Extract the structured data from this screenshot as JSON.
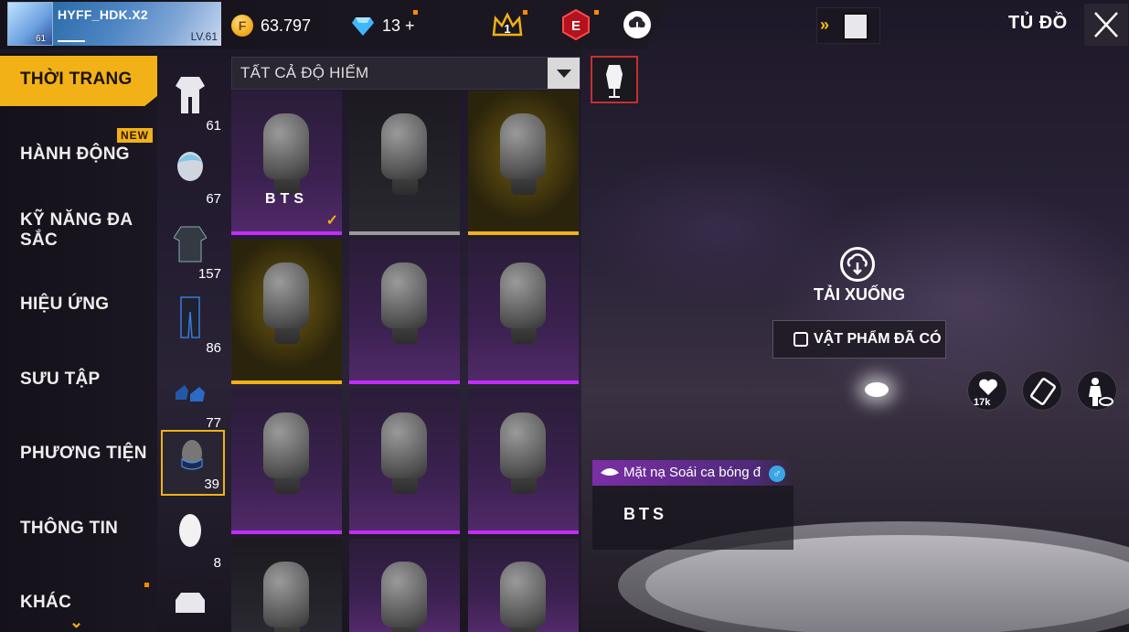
{
  "header": {
    "player_name": "HYFF_HDK.X2",
    "avatar_level": "61",
    "level_label": "LV.61",
    "coins": "63.797",
    "diamonds": "13",
    "diamond_plus": "+",
    "badge_rank": "1",
    "badge_elite": "E",
    "title": "TỦ ĐỒ",
    "forward_arrows": "»"
  },
  "menu": {
    "items": [
      {
        "label": "THỜI TRANG",
        "active": true
      },
      {
        "label": "HÀNH ĐỘNG",
        "badge": "NEW"
      },
      {
        "label": "KỸ NĂNG ĐA"
      },
      {
        "label": "SẮC"
      },
      {
        "label": "HIỆU ỨNG"
      },
      {
        "label": "SƯU TẬP"
      },
      {
        "label": "PHƯƠNG TIỆN"
      },
      {
        "label": "THÔNG TIN"
      },
      {
        "label": "KHÁC"
      }
    ],
    "more_arrow": "⌄"
  },
  "categories": [
    {
      "icon": "outfit-icon",
      "count": "61"
    },
    {
      "icon": "hair-icon",
      "count": "67"
    },
    {
      "icon": "top-icon",
      "count": "157"
    },
    {
      "icon": "pants-icon",
      "count": "86"
    },
    {
      "icon": "shoes-icon",
      "count": "77"
    },
    {
      "icon": "mask-icon",
      "count": "39",
      "selected": true
    },
    {
      "icon": "face-icon",
      "count": "8"
    },
    {
      "icon": "jacket-icon",
      "count": ""
    }
  ],
  "filter": {
    "label": "TẤT CẢ ĐỘ HIẾM"
  },
  "grid": {
    "items": [
      {
        "bg": "purple",
        "bar": "#c22cff",
        "text": "BTS",
        "equipped": true
      },
      {
        "bg": "dark",
        "bar": "#9a9a9a"
      },
      {
        "bg": "gold",
        "bar": "#f2b116"
      },
      {
        "bg": "gold",
        "bar": "#f2b116"
      },
      {
        "bg": "purple",
        "bar": "#c22cff"
      },
      {
        "bg": "purple",
        "bar": "#c22cff"
      },
      {
        "bg": "purple",
        "bar": "#c22cff"
      },
      {
        "bg": "purple",
        "bar": "#c22cff"
      },
      {
        "bg": "purple",
        "bar": "#c22cff"
      },
      {
        "bg": "dark",
        "bar": ""
      },
      {
        "bg": "purple",
        "bar": ""
      },
      {
        "bg": "purple",
        "bar": ""
      }
    ],
    "checkmark": "✓"
  },
  "preview": {
    "download_label": "TẢI XUỐNG",
    "owned_label": "VẬT PHẨM ĐÃ CÓ",
    "likes": "17k",
    "item_name": "Mặt nạ Soái ca bóng đ",
    "gender_symbol": "♂",
    "item_desc": "BTS"
  },
  "colors": {
    "accent": "#f2b116",
    "epic": "#c22cff",
    "warning_dot": "#ff8a00"
  }
}
